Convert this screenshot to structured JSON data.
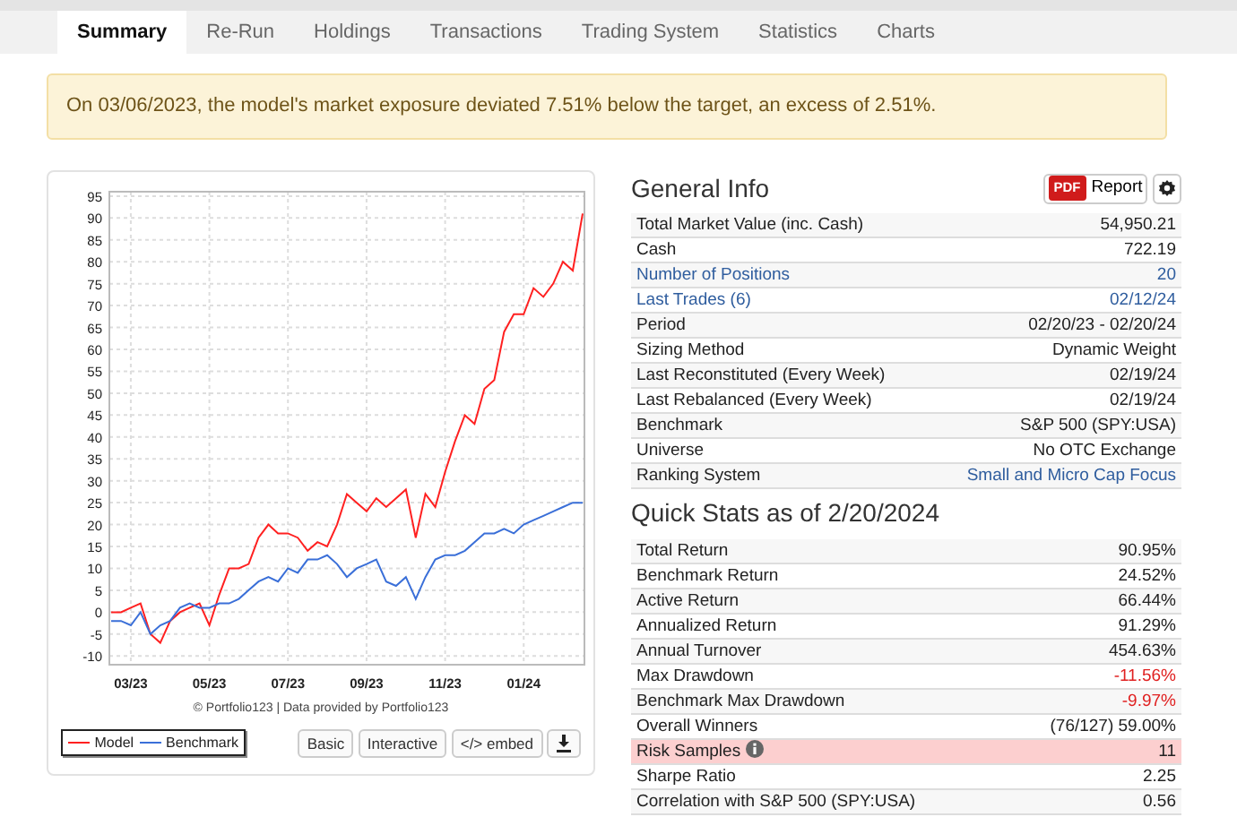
{
  "tabs": [
    {
      "label": "Summary",
      "selected": true
    },
    {
      "label": "Re-Run",
      "selected": false
    },
    {
      "label": "Holdings",
      "selected": false
    },
    {
      "label": "Transactions",
      "selected": false
    },
    {
      "label": "Trading System",
      "selected": false
    },
    {
      "label": "Statistics",
      "selected": false
    },
    {
      "label": "Charts",
      "selected": false
    }
  ],
  "alert": "On 03/06/2023, the model's market exposure deviated 7.51% below the target, an excess of 2.51%.",
  "chart": {
    "chart_data": {
      "type": "line",
      "grid": true,
      "ylim": [
        -12,
        96
      ],
      "yticks": [
        -10,
        -5,
        0,
        5,
        10,
        15,
        20,
        25,
        30,
        35,
        40,
        45,
        50,
        55,
        60,
        65,
        70,
        75,
        80,
        85,
        90,
        95
      ],
      "categories": [
        null,
        null,
        "03/23",
        null,
        null,
        null,
        null,
        null,
        null,
        null,
        "05/23",
        null,
        null,
        null,
        null,
        null,
        null,
        null,
        "07/23",
        null,
        null,
        null,
        null,
        null,
        null,
        null,
        "09/23",
        null,
        null,
        null,
        null,
        null,
        null,
        null,
        "11/23",
        null,
        null,
        null,
        null,
        null,
        null,
        null,
        "01/24",
        null,
        null,
        null,
        null,
        null,
        null
      ],
      "series": [
        {
          "name": "Model",
          "color": "#ff2020",
          "values": [
            0,
            0,
            1,
            2,
            -5,
            -7,
            -2,
            0,
            1,
            2,
            -3,
            4,
            10,
            10,
            11,
            17,
            20,
            18,
            18,
            17,
            14,
            16,
            15,
            20,
            27,
            25,
            23,
            26,
            24,
            26,
            28,
            17,
            27,
            24,
            32,
            39,
            45,
            43,
            51,
            53,
            64,
            68,
            68,
            74,
            72,
            75,
            80,
            78,
            91
          ]
        },
        {
          "name": "Benchmark",
          "color": "#3a6fd8",
          "values": [
            -2,
            -2,
            -3,
            0,
            -5,
            -3,
            -2,
            1,
            2,
            1,
            1,
            2,
            2,
            3,
            5,
            7,
            8,
            7,
            10,
            9,
            12,
            12,
            13,
            11,
            8,
            10,
            11,
            12,
            7,
            6,
            8,
            3,
            8,
            12,
            13,
            13,
            14,
            16,
            18,
            18,
            19,
            18,
            20,
            21,
            22,
            23,
            24,
            25,
            25
          ]
        }
      ]
    },
    "credit": "© Portfolio123 | Data provided by Portfolio123",
    "buttons": [
      "Basic",
      "Interactive",
      "</> embed"
    ]
  },
  "general": {
    "title": "General Info",
    "pdf": "PDF",
    "report": "Report",
    "rows": [
      {
        "label": "Total Market Value (inc. Cash)",
        "value": "54,950.21",
        "kind": "plain"
      },
      {
        "label": "Cash",
        "value": "722.19",
        "kind": "plain"
      },
      {
        "label": "Number of Positions",
        "value": "20",
        "kind": "link"
      },
      {
        "label": "Last Trades (6)",
        "value": "02/12/24",
        "kind": "link"
      },
      {
        "label": "Period",
        "value": "02/20/23 - 02/20/24",
        "kind": "plain"
      },
      {
        "label": "Sizing Method",
        "value": "Dynamic Weight",
        "kind": "plain"
      },
      {
        "label": "Last Reconstituted (Every Week)",
        "value": "02/19/24",
        "kind": "plain"
      },
      {
        "label": "Last Rebalanced (Every Week)",
        "value": "02/19/24",
        "kind": "plain"
      },
      {
        "label": "Benchmark",
        "value": "S&P 500 (SPY:USA)",
        "kind": "plain"
      },
      {
        "label": "Universe",
        "value": "No OTC Exchange",
        "kind": "plain"
      },
      {
        "label": "Ranking System",
        "value": "Small and Micro Cap Focus",
        "kind": "value-link"
      }
    ]
  },
  "quick_stats": {
    "title": "Quick Stats as of 2/20/2024",
    "rows": [
      {
        "label": "Total Return",
        "value": "90.95%",
        "kind": "plain"
      },
      {
        "label": "Benchmark Return",
        "value": "24.52%",
        "kind": "plain"
      },
      {
        "label": "Active Return",
        "value": "66.44%",
        "kind": "plain"
      },
      {
        "label": "Annualized Return",
        "value": "91.29%",
        "kind": "plain"
      },
      {
        "label": "Annual Turnover",
        "value": "454.63%",
        "kind": "plain"
      },
      {
        "label": "Max Drawdown",
        "value": "-11.56%",
        "kind": "negative"
      },
      {
        "label": "Benchmark Max Drawdown",
        "value": "-9.97%",
        "kind": "negative"
      },
      {
        "label": "Overall Winners",
        "value": "(76/127) 59.00%",
        "kind": "plain"
      },
      {
        "label": "Risk Samples",
        "value": "11",
        "kind": "warning"
      },
      {
        "label": "Sharpe Ratio",
        "value": "2.25",
        "kind": "plain"
      },
      {
        "label": "Correlation with S&P 500 (SPY:USA)",
        "value": "0.56",
        "kind": "plain"
      }
    ]
  }
}
